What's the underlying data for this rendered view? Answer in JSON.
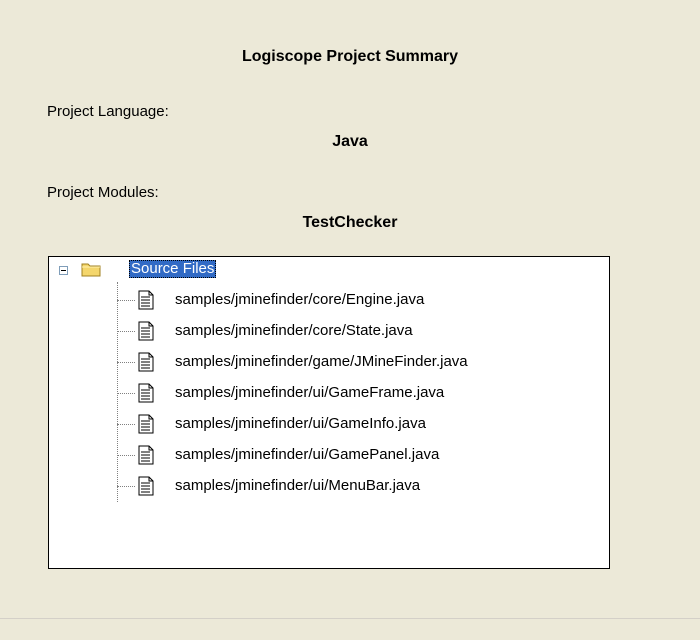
{
  "summary": {
    "title": "Logiscope Project Summary",
    "language_label": "Project Language:",
    "language_value": "Java",
    "modules_label": "Project Modules:",
    "modules_value": "TestChecker"
  },
  "tree": {
    "root": {
      "label": "Source Files",
      "icon": "folder-icon",
      "expanded": true,
      "selected": true
    },
    "files": [
      "samples/jminefinder/core/Engine.java",
      "samples/jminefinder/core/State.java",
      "samples/jminefinder/game/JMineFinder.java",
      "samples/jminefinder/ui/GameFrame.java",
      "samples/jminefinder/ui/GameInfo.java",
      "samples/jminefinder/ui/GamePanel.java",
      "samples/jminefinder/ui/MenuBar.java"
    ]
  },
  "colors": {
    "background": "#ece9d8",
    "selection": "#316ac5",
    "tree_background": "#ffffff"
  }
}
